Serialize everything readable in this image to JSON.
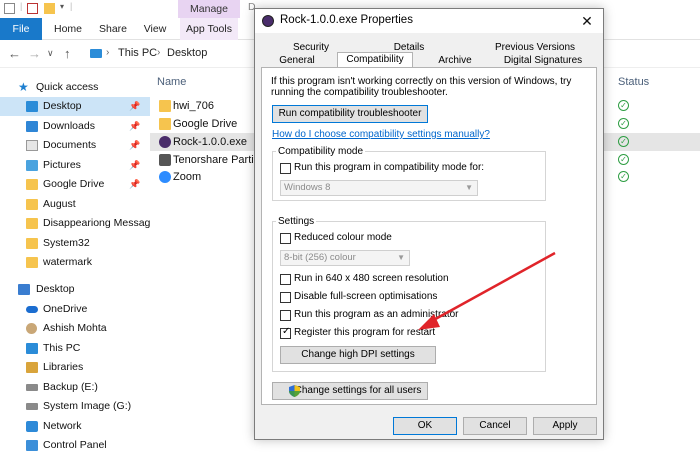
{
  "ribbon": {
    "manage_tab": "Manage",
    "desktop_tab_hint": "D",
    "tabs": [
      "File",
      "Home",
      "Share",
      "View",
      "App Tools"
    ]
  },
  "address": {
    "breadcrumb": [
      "This PC",
      "Desktop"
    ]
  },
  "nav": {
    "items": [
      {
        "label": "Quick access",
        "icon": "star-icon",
        "pinned": false
      },
      {
        "label": "Desktop",
        "icon": "desktop-icon",
        "pinned": true,
        "selected": true
      },
      {
        "label": "Downloads",
        "icon": "downloads-icon",
        "pinned": true
      },
      {
        "label": "Documents",
        "icon": "documents-icon",
        "pinned": true
      },
      {
        "label": "Pictures",
        "icon": "pictures-icon",
        "pinned": true
      },
      {
        "label": "Google Drive",
        "icon": "folder-icon",
        "pinned": true
      },
      {
        "label": "August",
        "icon": "folder-icon",
        "pinned": false
      },
      {
        "label": "Disappeariong Messag",
        "icon": "folder-icon",
        "pinned": false
      },
      {
        "label": "System32",
        "icon": "folder-icon",
        "pinned": false
      },
      {
        "label": "watermark",
        "icon": "folder-icon",
        "pinned": false
      },
      {
        "label": "Desktop",
        "icon": "desktop-icon",
        "pinned": false
      },
      {
        "label": "OneDrive",
        "icon": "cloud-icon",
        "pinned": false
      },
      {
        "label": "Ashish Mohta",
        "icon": "user-icon",
        "pinned": false
      },
      {
        "label": "This PC",
        "icon": "pc-icon",
        "pinned": false
      },
      {
        "label": "Libraries",
        "icon": "libraries-icon",
        "pinned": false
      },
      {
        "label": "Backup  (E:)",
        "icon": "drive-icon",
        "pinned": false
      },
      {
        "label": "System Image (G:)",
        "icon": "drive-icon",
        "pinned": false
      },
      {
        "label": "Network",
        "icon": "network-icon",
        "pinned": false
      },
      {
        "label": "Control Panel",
        "icon": "control-panel-icon",
        "pinned": false
      }
    ]
  },
  "files": {
    "name_header": "Name",
    "status_header": "Status",
    "rows": [
      {
        "name": "hwi_706",
        "icon": "folder-icon"
      },
      {
        "name": "Google Drive",
        "icon": "google-drive-icon"
      },
      {
        "name": "Rock-1.0.0.exe",
        "icon": "exe-icon",
        "selected": true
      },
      {
        "name": "Tenorshare Partitio",
        "icon": "app-shortcut-icon"
      },
      {
        "name": "Zoom",
        "icon": "zoom-icon"
      }
    ]
  },
  "dialog": {
    "title": "Rock-1.0.0.exe Properties",
    "tabs_row1": [
      "Security",
      "Details",
      "Previous Versions"
    ],
    "tabs_row2": [
      "General",
      "Compatibility",
      "Archive",
      "Digital Signatures"
    ],
    "active_tab": "Compatibility",
    "intro_line1": "If this program isn't working correctly on this version of Windows, try",
    "intro_line2": "running the compatibility troubleshooter.",
    "troubleshooter_button": "Run compatibility troubleshooter",
    "help_link": "How do I choose compatibility settings manually?",
    "compat_group": {
      "label": "Compatibility mode",
      "checkbox": "Run this program in compatibility mode for:",
      "checked": false,
      "select_value": "Windows 8"
    },
    "settings_group": {
      "label": "Settings",
      "reduced_colour": "Reduced colour mode",
      "colour_select": "8-bit (256) colour",
      "res_640": "Run in 640 x 480 screen resolution",
      "fullscreen": "Disable full-screen optimisations",
      "admin": "Run this program as an administrator",
      "restart": "Register this program for restart",
      "restart_checked": true,
      "dpi_button": "Change high DPI settings"
    },
    "all_users_button": "Change settings for all users",
    "ok": "OK",
    "cancel": "Cancel",
    "apply": "Apply"
  },
  "colors": {
    "file_tab": "#1979ca",
    "manage_tab": "#e8d4f2",
    "selection": "#cce4f7",
    "link": "#0066cc",
    "arrow": "#e0242a"
  }
}
